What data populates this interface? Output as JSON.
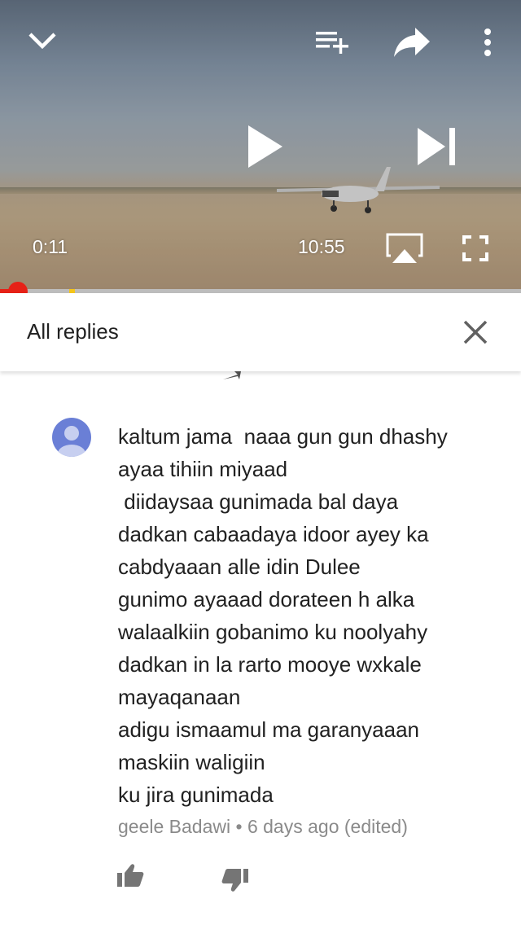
{
  "player": {
    "current_time": "0:11",
    "duration": "10:55",
    "progress_fraction": 0.017,
    "controls": {
      "minimize": "chevron-down-icon",
      "add_to_playlist": "playlist-add-icon",
      "share": "share-icon",
      "more": "more-vert-icon",
      "play": "play-icon",
      "next": "skip-next-icon",
      "cast": "airplay-icon",
      "fullscreen": "fullscreen-icon"
    }
  },
  "replies_panel": {
    "title": "All replies",
    "close_icon": "close-icon"
  },
  "comment": {
    "text": "kaltum jama  naaa gun gun dhashy\nayaa tihiin miyaad\n diidaysaa gunimada bal daya\ndadkan cabaadaya idoor ayey ka\ncabdyaaan alle idin Dulee\ngunimo ayaaad dorateen h alka\nwalaalkiin gobanimo ku noolyahy\ndadkan in la rarto mooye wxkale\nmayaqanaan\nadigu ismaamul ma garanyaaan\nmaskiin waligiin\nku jira gunimada",
    "author": "geele Badawi",
    "separator": "•",
    "time": "6 days ago",
    "edited": "(edited)"
  },
  "colors": {
    "progress": "#e62117",
    "avatar": "#6a7fd6",
    "meta_text": "#8a8a8a"
  }
}
